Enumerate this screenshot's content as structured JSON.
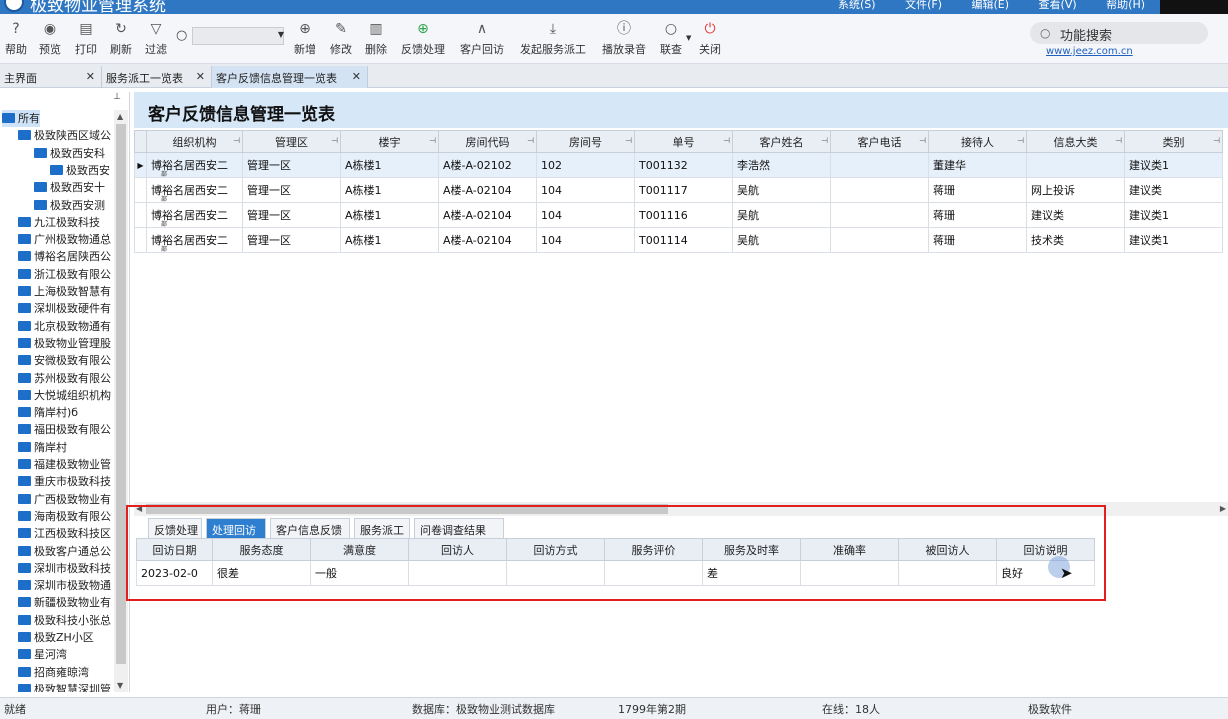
{
  "app": {
    "title": "极致物业管理系统",
    "menu": [
      "系统(S)",
      "文件(F)",
      "编辑(E)",
      "查看(V)",
      "帮助(H)"
    ]
  },
  "toolbar": {
    "help": "帮助",
    "preview": "预览",
    "print": "打印",
    "refresh": "刷新",
    "filter": "过滤",
    "search_value": "",
    "add": "新增",
    "edit": "修改",
    "delete": "删除",
    "feedback": "反馈处理",
    "revisit": "客户回访",
    "dispatch": "发起服务派工",
    "play": "播放录音",
    "linked": "联查",
    "close": "关闭",
    "func_search": "功能搜索",
    "site": "www.jeez.com.cn"
  },
  "tabs": [
    {
      "label": "主界面"
    },
    {
      "label": "服务派工一览表"
    },
    {
      "label": "客户反馈信息管理一览表"
    }
  ],
  "tree": {
    "items": [
      "所有",
      "极致陕西区域公",
      "极致西安科",
      "极致西安",
      "极致西安十",
      "极致西安测",
      "九江极致科技",
      "广州极致物通总",
      "博裕名居陕西公",
      "浙江极致有限公",
      "上海极致智慧有",
      "深圳极致硬件有",
      "北京极致物通有",
      "极致物业管理股",
      "安微极致有限公",
      "苏州极致有限公",
      "大悦城组织机构",
      "隋岸村)б",
      "福田极致有限公",
      "隋岸村",
      "福建极致物业管",
      "重庆市极致科技",
      "广西极致物业有",
      "海南极致有限公",
      "江西极致科技区",
      "极致客户通总公",
      "深圳市极致科技",
      "深圳市极致物通",
      "新疆极致物业有",
      "极致科技小张总",
      "极致ZH小区",
      "星河湾",
      "招商雍晾湾",
      "极致智慧深圳管"
    ]
  },
  "page_title": "客户反馈信息管理一览表",
  "main_grid": {
    "columns": [
      "组织机构",
      "管理区",
      "楼宇",
      "房间代码",
      "房间号",
      "单号",
      "客户姓名",
      "客户电话",
      "接待人",
      "信息大类",
      "类别"
    ],
    "rows": [
      [
        "博裕名居西安二",
        "管理一区",
        "A栋楼1",
        "A楼-A-02102",
        "102",
        "T001132",
        "李浩然",
        "",
        "董建华",
        "",
        "建议类1"
      ],
      [
        "博裕名居西安二",
        "管理一区",
        "A栋楼1",
        "A楼-A-02104",
        "104",
        "T001117",
        "吴航",
        "",
        "蒋珊",
        "网上投诉",
        "建议类"
      ],
      [
        "博裕名居西安二",
        "管理一区",
        "A栋楼1",
        "A楼-A-02104",
        "104",
        "T001116",
        "吴航",
        "",
        "蒋珊",
        "建议类",
        "建议类1"
      ],
      [
        "博裕名居西安二",
        "管理一区",
        "A栋楼1",
        "A楼-A-02104",
        "104",
        "T001114",
        "吴航",
        "",
        "蒋珊",
        "技术类",
        "建议类1"
      ]
    ],
    "org_suffix": "部"
  },
  "sub_tabs": [
    {
      "label": "反馈处理"
    },
    {
      "label": "处理回访"
    },
    {
      "label": "客户信息反馈"
    },
    {
      "label": "服务派工"
    },
    {
      "label": "问卷调查结果"
    }
  ],
  "sub_grid": {
    "columns": [
      "回访日期",
      "服务态度",
      "满意度",
      "回访人",
      "回访方式",
      "服务评价",
      "服务及时率",
      "准确率",
      "被回访人",
      "回访说明"
    ],
    "rows": [
      [
        "2023-02-0",
        "很差",
        "一般",
        "",
        "",
        "",
        "差",
        "",
        "",
        "良好"
      ]
    ]
  },
  "status": {
    "state": "就绪",
    "user": "用户：蒋珊",
    "database": "数据库：极致物业测试数据库",
    "period": "1799年第2期",
    "online": "在线：18人",
    "vendor": "极致软件"
  },
  "colors": {
    "title_bar": "#2f77c2",
    "active_subtab": "#2f7fd0",
    "highlight_box": "#e02020",
    "page_title_bg": "#d6e7f7"
  }
}
